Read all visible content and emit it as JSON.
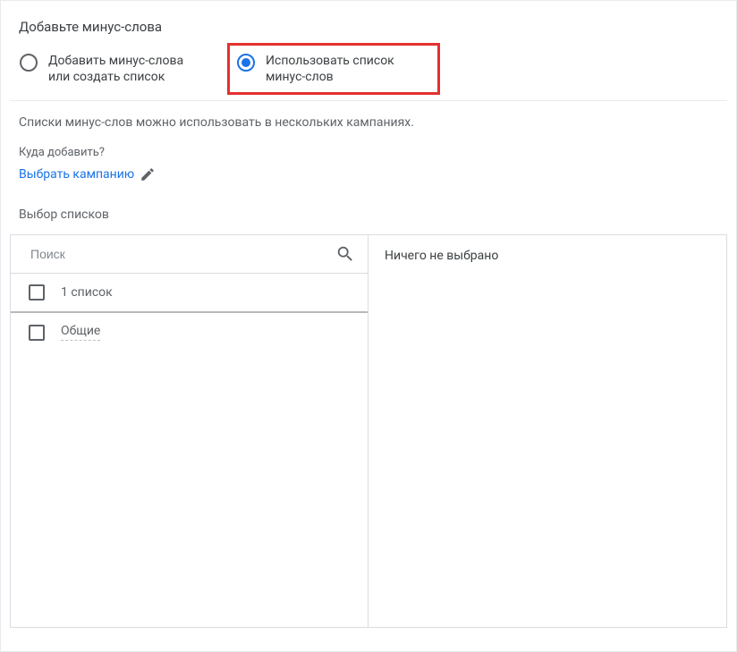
{
  "panel": {
    "title": "Добавьте минус-слова"
  },
  "radios": {
    "option1": "Добавить минус-слова или создать список",
    "option2": "Использовать список минус-слов"
  },
  "info": "Списки минус-слов можно использовать в нескольких кампаниях.",
  "where": {
    "label": "Куда добавить?",
    "select": "Выбрать кампанию"
  },
  "lists": {
    "label": "Выбор списков",
    "search_placeholder": "Поиск",
    "count_label": "1 список",
    "items": [
      "Общие"
    ],
    "empty": "Ничего не выбрано"
  }
}
